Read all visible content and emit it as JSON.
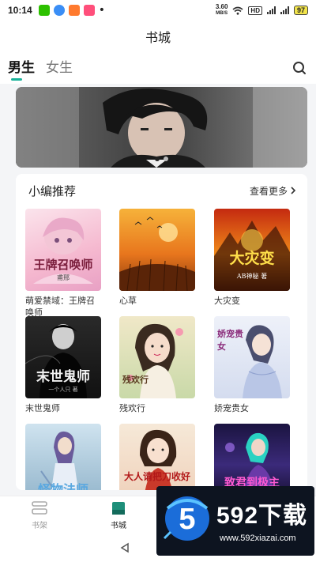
{
  "status_bar": {
    "time": "10:14",
    "dot": "•",
    "speed_value": "3.60",
    "speed_unit": "MB/S",
    "hd_badge": "HD",
    "battery": "97",
    "icons": [
      "wechat-icon",
      "browser-icon",
      "shop-icon",
      "chat-icon",
      "wifi-icon",
      "signal-icon"
    ]
  },
  "header": {
    "title": "书城"
  },
  "tabs": {
    "male": "男生",
    "female": "女生"
  },
  "section": {
    "title": "小编推荐",
    "see_more": "查看更多"
  },
  "books": [
    {
      "title": "萌爱禁域：王牌召唤师",
      "cover_text": "王牌召唤师",
      "cover_sub": "甫邢"
    },
    {
      "title": "心草",
      "cover_text": "心草",
      "cover_sub": ""
    },
    {
      "title": "大灾变",
      "cover_text": "大灾变",
      "cover_sub": "AB神秘 著"
    },
    {
      "title": "末世鬼师",
      "cover_text": "末世鬼师",
      "cover_sub": "一个人只 著"
    },
    {
      "title": "残欢行",
      "cover_text": "残欢行",
      "cover_sub": ""
    },
    {
      "title": "娇宠贵女",
      "cover_text": "娇宠贵女",
      "cover_sub": ""
    },
    {
      "title": "",
      "cover_text": "怪物法师",
      "cover_sub": ""
    },
    {
      "title": "",
      "cover_text": "大人请把刀收好",
      "cover_sub": ""
    },
    {
      "title": "",
      "cover_text": "致君到极主",
      "cover_sub": ""
    }
  ],
  "bottom_nav": {
    "shelf": "书架",
    "store": "书城"
  },
  "watermark": {
    "brand": "592下载",
    "url": "www.592xiazai.com",
    "logo_digit": "5"
  },
  "colors": {
    "accent": "#19b39a",
    "background": "#f4f5f7"
  }
}
